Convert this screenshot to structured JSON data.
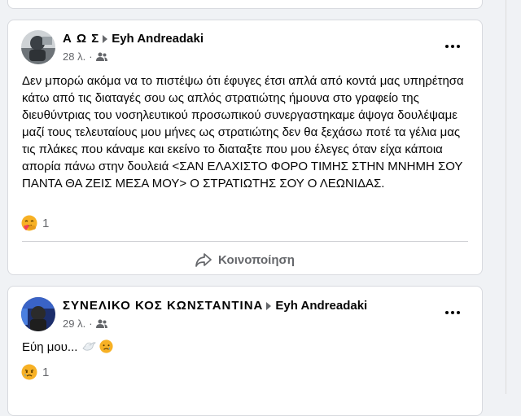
{
  "post1": {
    "author": "Α      Ω          Σ",
    "target": "Eyh Andreadaki",
    "time": "28 λ.",
    "separator": "·",
    "audience_icon": "friends-icon",
    "text": "Δεν μπορώ ακόμα να το πιστέψω ότι έφυγες έτσι απλά από κοντά μας υπηρέτησα κάτω από τις διαταγές σου ως απλός στρατιώτης ήμουνα στο γραφείο της διευθύντριας του νοσηλευτικού προσωπικού συνεργαστηκαμε άψογα δουλέψαμε μαζί τους τελευταίους μου μήνες ως στρατιώτης δεν θα ξεχάσω ποτέ τα γέλια μας τις πλάκες που κάναμε και εκείνο το διαταξτε που μου έλεγες όταν είχα κάποια απορία πάνω στην δουλειά <ΣΑΝ ΕΛΑΧΙΣΤΟ ΦΟΡΟ ΤΙΜΗΣ ΣΤΗΝ ΜΝΗΜΗ ΣΟΥ ΠΑΝΤΑ ΘΑ ΖΕΙΣ ΜΕΣΑ ΜΟΥ> Ο ΣΤΡΑΤΙΩΤΗΣ ΣΟΥ Ο ΛΕΩΝΙΔΑΣ.",
    "reaction_icon": "care-reaction-icon",
    "reaction_count": "1",
    "share_label": "Κοινοποίηση"
  },
  "post2": {
    "author": "ΣΥΝΕΛΙΚΟ     ΚΟΣ ΚΩΝΣΤΑΝΤΙΝΑ",
    "target": "Eyh Andreadaki",
    "time": "29 λ.",
    "separator": "·",
    "audience_icon": "friends-icon",
    "text": "Εύη μου...",
    "emojis": [
      "dove-icon",
      "sad-face-icon"
    ],
    "reaction_icon": "sad-reaction-icon",
    "reaction_count": "1"
  },
  "colors": {
    "background": "#f0f2f5",
    "card": "#ffffff",
    "secondary_text": "#65676b",
    "reaction_yellow": "#f7b125"
  }
}
